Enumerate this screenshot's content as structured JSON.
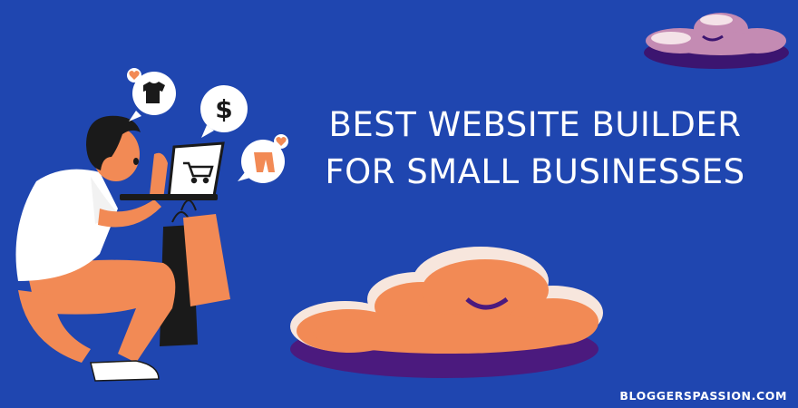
{
  "banner": {
    "title_line1": "BEST WEBSITE BUILDER",
    "title_line2": "FOR SMALL BUSINESSES",
    "site": "BLOGGERSPASSION.COM",
    "bubble_dollar": "$"
  },
  "icons": [
    "tshirt-icon",
    "heart-icon",
    "dollar-icon",
    "pants-icon",
    "shopping-cart-icon",
    "shopping-bag-icon",
    "laptop-icon"
  ],
  "colors": {
    "background": "#1f46b0",
    "cloud_orange": "#f28a55",
    "cloud_cream": "#f7e6dd",
    "cloud_purple": "#4b1a7e",
    "cloud_pink": "#c48bb3",
    "text": "#ffffff"
  }
}
